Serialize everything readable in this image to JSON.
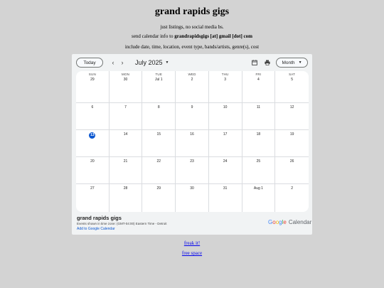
{
  "site": {
    "title": "grand rapids gigs",
    "tagline": "just listings, no social media bs.",
    "send_prefix": "send calendar info to ",
    "send_email": "grandrapidsgigs [at] gmail [dot] com",
    "include_line": "include date, time, location, event type, bands/artists, genre(s), cost"
  },
  "calendar": {
    "today_label": "Today",
    "month_label": "July 2025",
    "view_label": "Month",
    "prev_icon": "chevron-left-icon",
    "next_icon": "chevron-right-icon",
    "print_icon": "print-icon",
    "agenda_icon": "calendar-icon",
    "weekdays": [
      "SUN",
      "MON",
      "TUE",
      "WED",
      "THU",
      "FRI",
      "SAT"
    ],
    "weeks": [
      [
        "29",
        "30",
        "Jul 1",
        "2",
        "3",
        "4",
        "5"
      ],
      [
        "6",
        "7",
        "8",
        "9",
        "10",
        "11",
        "12"
      ],
      [
        "13",
        "14",
        "15",
        "16",
        "17",
        "18",
        "19"
      ],
      [
        "20",
        "21",
        "22",
        "23",
        "24",
        "25",
        "26"
      ],
      [
        "27",
        "28",
        "29",
        "30",
        "31",
        "Aug 1",
        "2"
      ]
    ],
    "today_day": "13",
    "accent_color": "#0b57d0",
    "footer": {
      "name": "grand rapids gigs",
      "timezone": "Events shown in time zone: (GMT-04:00) Eastern Time - Detroit",
      "add_link": "Add to Google Calendar",
      "brand_google": "Google",
      "brand_calendar": "Calendar"
    }
  },
  "links": {
    "freak": "freak it!",
    "free_space": "free space"
  }
}
